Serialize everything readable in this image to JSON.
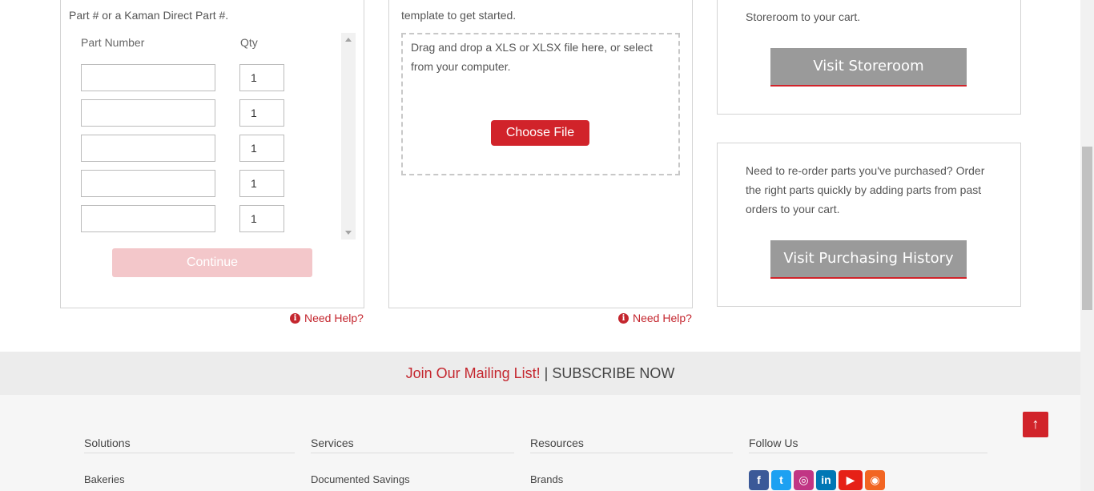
{
  "quick_order": {
    "intro_text": "Part # or a Kaman Direct Part #.",
    "col_part": "Part Number",
    "col_qty": "Qty",
    "rows": [
      {
        "part": "",
        "qty": "1"
      },
      {
        "part": "",
        "qty": "1"
      },
      {
        "part": "",
        "qty": "1"
      },
      {
        "part": "",
        "qty": "1"
      },
      {
        "part": "",
        "qty": "1"
      }
    ],
    "continue_label": "Continue",
    "help_label": "Need Help?"
  },
  "upload": {
    "intro_text": "template to get started.",
    "dropzone_text": "Drag and drop a XLS or XLSX file here, or select from your computer.",
    "choose_label": "Choose File",
    "help_label": "Need Help?"
  },
  "storeroom": {
    "intro_text": "Storeroom to your cart.",
    "button_label": "Visit Storeroom"
  },
  "history": {
    "text": "Need to re-order parts you've purchased? Order the right parts quickly by adding parts from past orders to your cart.",
    "button_label": "Visit Purchasing History"
  },
  "mailing": {
    "join": "Join Our Mailing List!",
    "separator": "|",
    "subscribe": "SUBSCRIBE NOW"
  },
  "footer": {
    "columns": [
      {
        "heading": "Solutions",
        "link": "Bakeries"
      },
      {
        "heading": "Services",
        "link": "Documented Savings"
      },
      {
        "heading": "Resources",
        "link": "Brands"
      },
      {
        "heading": "Follow Us"
      }
    ],
    "social_icons": [
      "facebook-icon",
      "twitter-icon",
      "instagram-icon",
      "linkedin-icon",
      "youtube-icon",
      "rss-icon"
    ]
  },
  "colors": {
    "brand_red": "#d1232a",
    "button_gray": "#9a9a9a",
    "disabled_pink": "#f3c7ca"
  }
}
